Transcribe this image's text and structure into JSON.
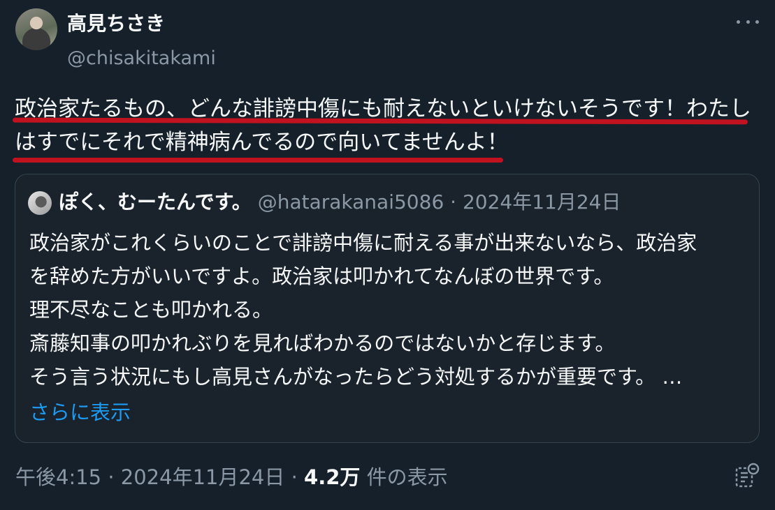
{
  "author": {
    "display_name": "高見ちさき",
    "handle": "@chisakitakami"
  },
  "tweet": {
    "lines": [
      "政治家たるもの、どんな誹謗中傷にも耐えないといけないそうです！わたし",
      "はすでにそれで精神病んでるので向いてませんよ！"
    ],
    "underline_color": "#c1121f"
  },
  "quote": {
    "display_name": "ぽく、むーたんです。",
    "handle": "@hatarakanai5086",
    "separator": "·",
    "date": "2024年11月24日",
    "lines": [
      "政治家がこれくらいのことで誹謗中傷に耐える事が出来ないなら、政治家",
      "を辞めた方がいいですよ。政治家は叩かれてなんぼの世界です。",
      "理不尽なことも叩かれる。",
      "斎藤知事の叩かれぶりを見ればわかるのではないかと存じます。",
      "そう言う状況にもし高見さんがなったらどう対処するかが重要です。 …"
    ],
    "show_more_label": "さらに表示"
  },
  "meta": {
    "time": "午後4:15",
    "sep1": "·",
    "date": "2024年11月24日",
    "sep2": "·",
    "views_count": "4.2万",
    "views_label": "件の表示"
  },
  "colors": {
    "background": "#15202b",
    "text_primary": "#f7f9f9",
    "text_secondary": "#8b98a5",
    "link": "#1d9bf0",
    "border": "#38444d"
  },
  "icons": {
    "more": "more-horizontal-icon",
    "analytics": "analytics-icon"
  }
}
